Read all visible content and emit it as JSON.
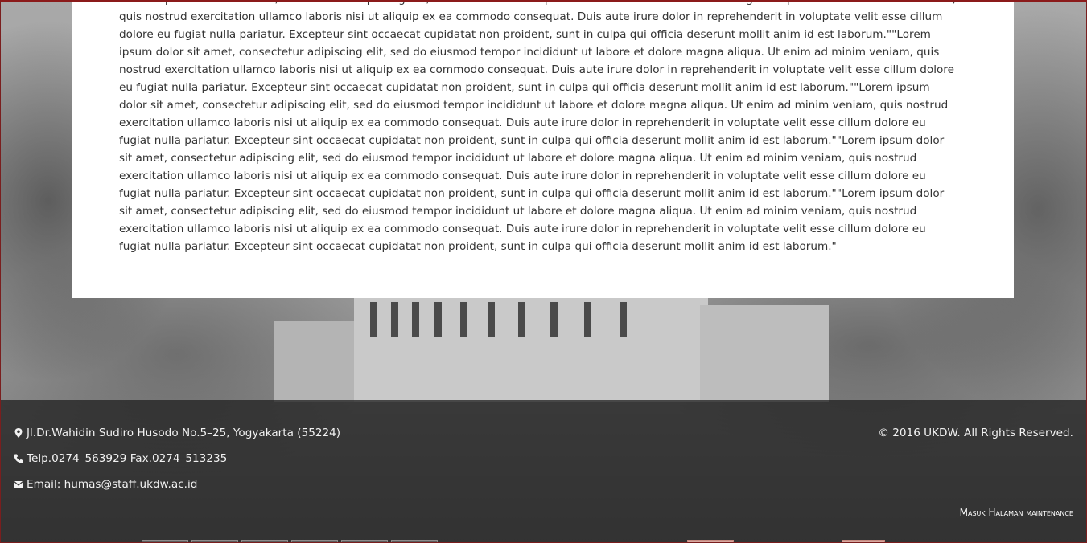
{
  "content": {
    "body_text": "\"Lorem ipsum dolor sit amet, consectetur adipiscing elit, sed do eiusmod tempor incididunt ut labore et dolore magna aliqua. Ut enim ad minim veniam, quis nostrud exercitation ullamco laboris nisi ut aliquip ex ea commodo consequat. Duis aute irure dolor in reprehenderit in voluptate velit esse cillum dolore eu fugiat nulla pariatur. Excepteur sint occaecat cupidatat non proident, sunt in culpa qui officia deserunt mollit anim id est laborum.\"\"Lorem ipsum dolor sit amet, consectetur adipiscing elit, sed do eiusmod tempor incididunt ut labore et dolore magna aliqua. Ut enim ad minim veniam, quis nostrud exercitation ullamco laboris nisi ut aliquip ex ea commodo consequat. Duis aute irure dolor in reprehenderit in voluptate velit esse cillum dolore eu fugiat nulla pariatur. Excepteur sint occaecat cupidatat non proident, sunt in culpa qui officia deserunt mollit anim id est laborum.\"\"Lorem ipsum dolor sit amet, consectetur adipiscing elit, sed do eiusmod tempor incididunt ut labore et dolore magna aliqua. Ut enim ad minim veniam, quis nostrud exercitation ullamco laboris nisi ut aliquip ex ea commodo consequat. Duis aute irure dolor in reprehenderit in voluptate velit esse cillum dolore eu fugiat nulla pariatur. Excepteur sint occaecat cupidatat non proident, sunt in culpa qui officia deserunt mollit anim id est laborum.\"\"Lorem ipsum dolor sit amet, consectetur adipiscing elit, sed do eiusmod tempor incididunt ut labore et dolore magna aliqua. Ut enim ad minim veniam, quis nostrud exercitation ullamco laboris nisi ut aliquip ex ea commodo consequat. Duis aute irure dolor in reprehenderit in voluptate velit esse cillum dolore eu fugiat nulla pariatur. Excepteur sint occaecat cupidatat non proident, sunt in culpa qui officia deserunt mollit anim id est laborum.\"\"Lorem ipsum dolor sit amet, consectetur adipiscing elit, sed do eiusmod tempor incididunt ut labore et dolore magna aliqua. Ut enim ad minim veniam, quis nostrud exercitation ullamco laboris nisi ut aliquip ex ea commodo consequat. Duis aute irure dolor in reprehenderit in voluptate velit esse cillum dolore eu fugiat nulla pariatur. Excepteur sint occaecat cupidatat non proident, sunt in culpa qui officia deserunt mollit anim id est laborum.\""
  },
  "footer": {
    "address": "Jl.Dr.Wahidin Sudiro Husodo No.5–25, Yogyakarta (55224)",
    "phone": "Telp.0274–563929 Fax.0274–513235",
    "email": "Email: humas@staff.ukdw.ac.id",
    "copyright": "© 2016 UKDW. All Rights Reserved.",
    "maintenance_link": "Masuk Halaman maintenance",
    "address_icon": "map-marker-icon",
    "phone_icon": "phone-icon",
    "email_icon": "envelope-icon"
  },
  "colors": {
    "panel_background": "#ffffff",
    "body_text": "#333333",
    "footer_overlay": "rgba(35,35,35,0.78)",
    "footer_text": "#f2f2f2",
    "frame_border": "#8b1a1a"
  }
}
